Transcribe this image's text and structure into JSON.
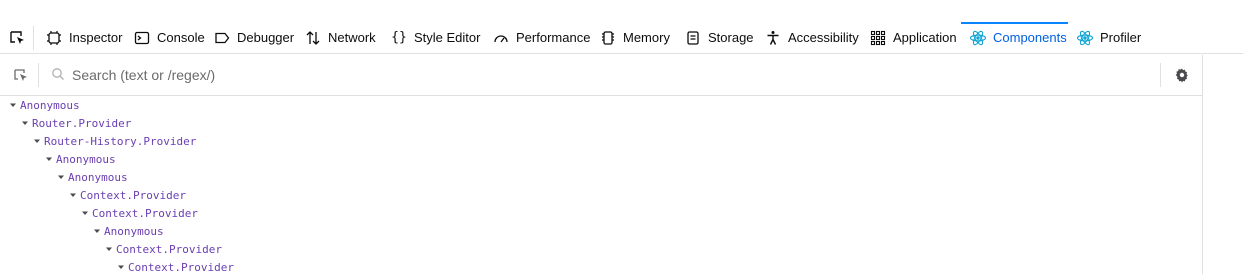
{
  "toolbar": {
    "tabs": [
      {
        "label": "Inspector",
        "icon": "inspector-icon"
      },
      {
        "label": "Console",
        "icon": "console-icon"
      },
      {
        "label": "Debugger",
        "icon": "debugger-icon"
      },
      {
        "label": "Network",
        "icon": "network-icon"
      },
      {
        "label": "Style Editor",
        "icon": "style-editor-icon"
      },
      {
        "label": "Performance",
        "icon": "performance-icon"
      },
      {
        "label": "Memory",
        "icon": "memory-icon"
      },
      {
        "label": "Storage",
        "icon": "storage-icon"
      },
      {
        "label": "Accessibility",
        "icon": "accessibility-icon"
      },
      {
        "label": "Application",
        "icon": "application-icon"
      },
      {
        "label": "Components",
        "icon": "react-icon",
        "selected": true
      },
      {
        "label": "Profiler",
        "icon": "react-icon"
      }
    ]
  },
  "search": {
    "placeholder": "Search (text or /regex/)",
    "value": ""
  },
  "tree": {
    "nodes": [
      {
        "name": "Anonymous",
        "depth": 0,
        "expanded": true
      },
      {
        "name": "Router.Provider",
        "depth": 1,
        "expanded": true
      },
      {
        "name": "Router-History.Provider",
        "depth": 2,
        "expanded": true
      },
      {
        "name": "Anonymous",
        "depth": 3,
        "expanded": true
      },
      {
        "name": "Anonymous",
        "depth": 4,
        "expanded": true
      },
      {
        "name": "Context.Provider",
        "depth": 5,
        "expanded": true
      },
      {
        "name": "Context.Provider",
        "depth": 6,
        "expanded": true
      },
      {
        "name": "Anonymous",
        "depth": 7,
        "expanded": true
      },
      {
        "name": "Context.Provider",
        "depth": 8,
        "expanded": true
      },
      {
        "name": "Context.Provider",
        "depth": 9,
        "expanded": true
      }
    ]
  },
  "colors": {
    "accent": "#0060df",
    "selected_tab_bar": "#0a84ff",
    "component_name": "#6a3fb3",
    "react_icon": "#0ea5d6"
  }
}
